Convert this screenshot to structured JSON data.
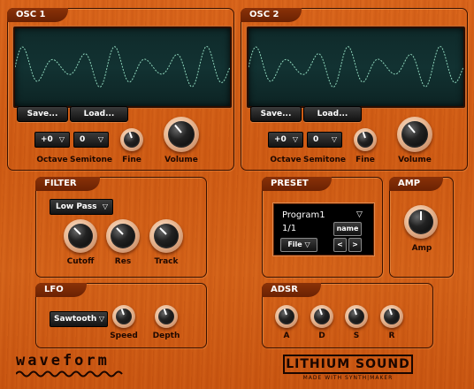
{
  "osc1": {
    "title": "OSC 1",
    "save": "Save...",
    "load": "Load...",
    "octave_value": "+0",
    "semitone_value": "0",
    "octave_label": "Octave",
    "semitone_label": "Semitone",
    "fine_label": "Fine",
    "volume_label": "Volume"
  },
  "osc2": {
    "title": "OSC 2",
    "save": "Save...",
    "load": "Load...",
    "octave_value": "+0",
    "semitone_value": "0",
    "octave_label": "Octave",
    "semitone_label": "Semitone",
    "fine_label": "Fine",
    "volume_label": "Volume"
  },
  "filter": {
    "title": "FILTER",
    "type_value": "Low Pass",
    "cutoff_label": "Cutoff",
    "res_label": "Res",
    "track_label": "Track"
  },
  "preset": {
    "title": "PRESET",
    "program": "Program1",
    "index": "1/1",
    "name_btn": "name",
    "file_btn": "File",
    "prev": "<",
    "next": ">"
  },
  "amp": {
    "title": "AMP",
    "amp_label": "Amp"
  },
  "lfo": {
    "title": "LFO",
    "wave_value": "Sawtooth",
    "speed_label": "Speed",
    "depth_label": "Depth"
  },
  "adsr": {
    "title": "ADSR",
    "a_label": "A",
    "d_label": "D",
    "s_label": "S",
    "r_label": "R"
  },
  "branding": {
    "waveform": "waveform",
    "lithium": "LITHIUM SOUND",
    "made_with": "MADE WITH SYNTH|MAKER"
  },
  "colors": {
    "wood": "#d35f17",
    "display_bg": "#123232",
    "wave_line": "#8fd6bc",
    "panel_border": "#3a1200"
  },
  "icons": {
    "dropdown": "triangle-down-icon",
    "waveform_logo": "squiggle-wave-icon"
  }
}
